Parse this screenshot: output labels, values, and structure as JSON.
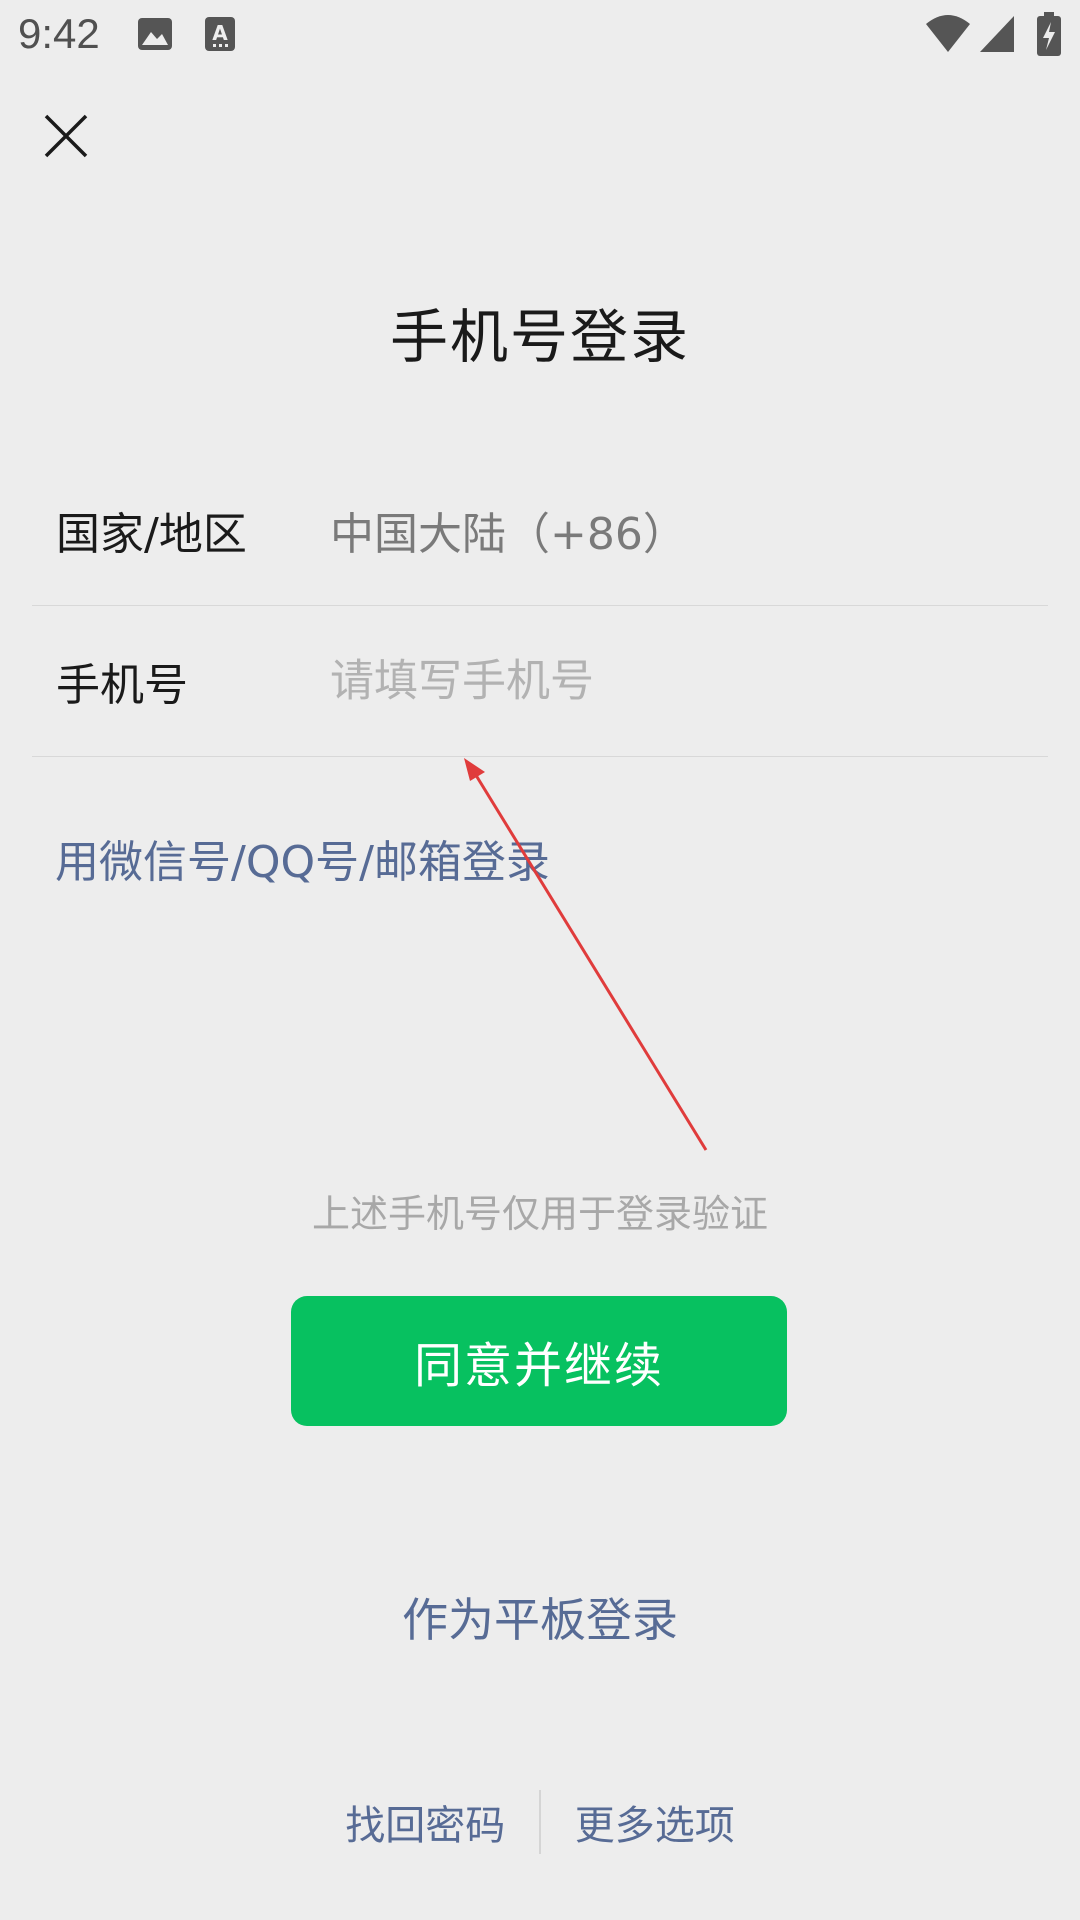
{
  "status_bar": {
    "time": "9:42",
    "icons": [
      "image-icon",
      "font-icon",
      "wifi-icon",
      "signal-icon",
      "battery-charging-icon"
    ]
  },
  "header": {
    "close_icon": "close-icon"
  },
  "main": {
    "title": "手机号登录",
    "country_row": {
      "label": "国家/地区",
      "value": "中国大陆（+86）"
    },
    "phone_row": {
      "label": "手机号",
      "value": "",
      "placeholder": "请填写手机号"
    },
    "alt_login_link": "用微信号/QQ号/邮箱登录",
    "notice": "上述手机号仅用于登录验证",
    "agree_button": "同意并继续",
    "tablet_login_link": "作为平板登录"
  },
  "footer": {
    "recover_password": "找回密码",
    "more_options": "更多选项"
  },
  "colors": {
    "background": "#ededed",
    "accent_green": "#07c160",
    "link_blue": "#576b95",
    "annotation_arrow": "#e03c3c"
  }
}
